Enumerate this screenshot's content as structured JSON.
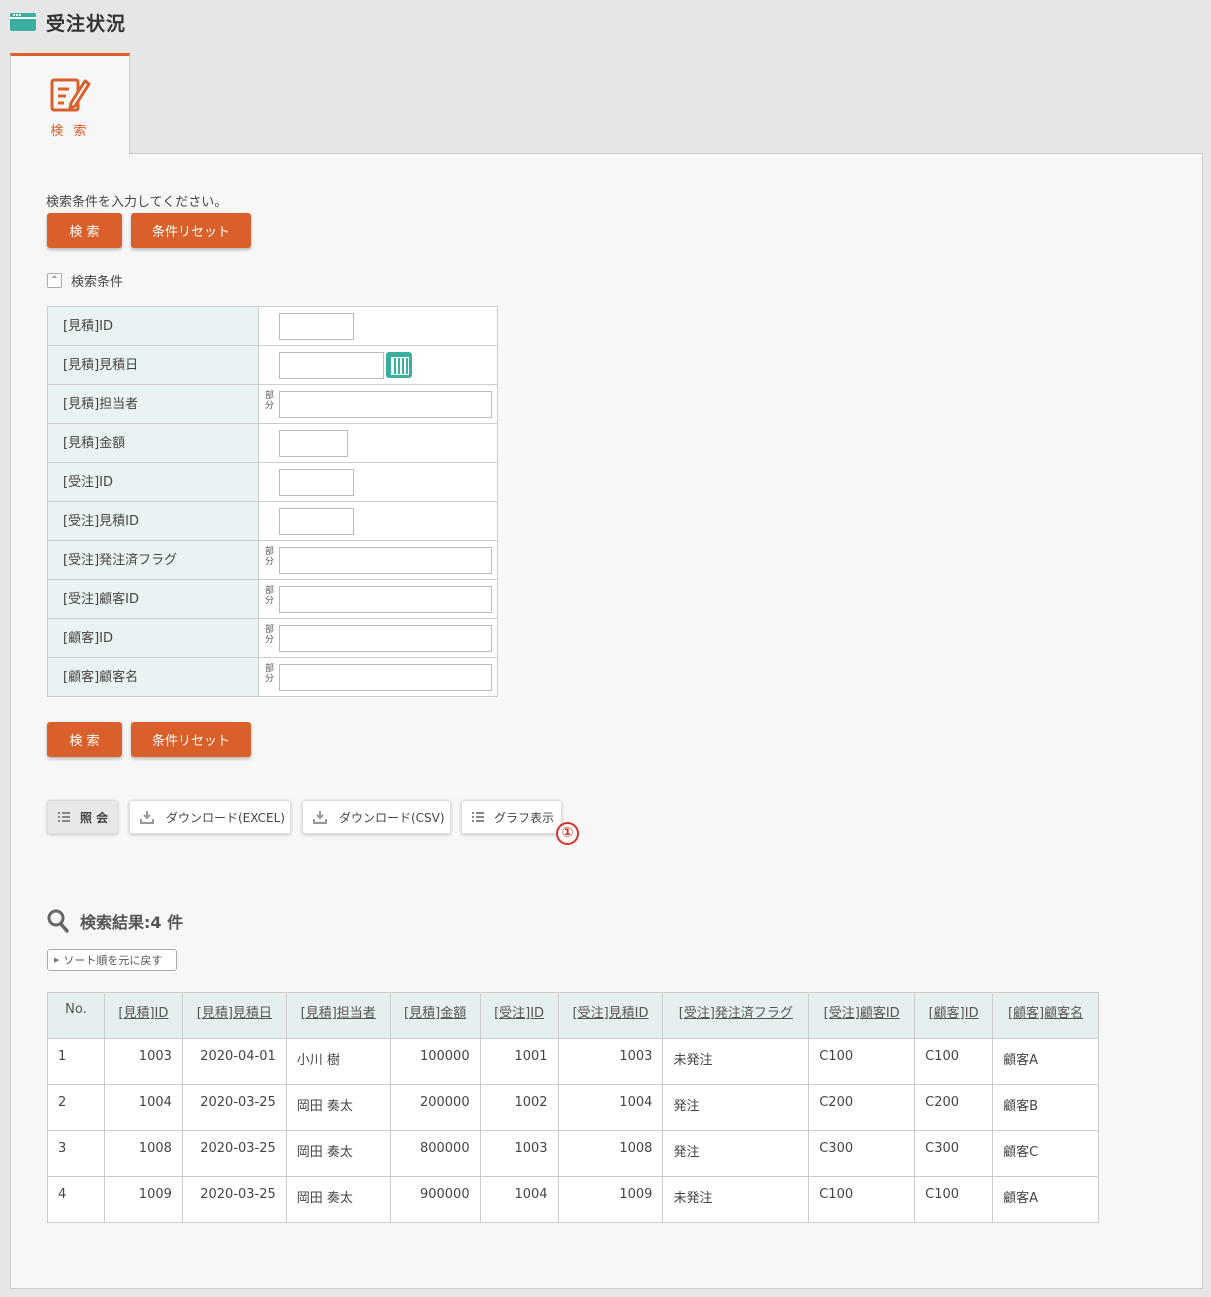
{
  "header": {
    "title": "受注状況",
    "icon": "window-icon"
  },
  "tab": {
    "label": "検 索",
    "icon": "edit-form-icon"
  },
  "form": {
    "instruction": "検索条件を入力してください。",
    "search_label": "検 索",
    "reset_label": "条件リセット",
    "conditions_toggle": "検索条件",
    "partial_label": "部分",
    "fields": [
      {
        "label": "[見積]ID",
        "value": ""
      },
      {
        "label": "[見積]見積日",
        "value": ""
      },
      {
        "label": "[見積]担当者",
        "value": ""
      },
      {
        "label": "[見積]金額",
        "value": ""
      },
      {
        "label": "[受注]ID",
        "value": ""
      },
      {
        "label": "[受注]見積ID",
        "value": ""
      },
      {
        "label": "[受注]発注済フラグ",
        "value": ""
      },
      {
        "label": "[受注]顧客ID",
        "value": ""
      },
      {
        "label": "[顧客]ID",
        "value": ""
      },
      {
        "label": "[顧客]顧客名",
        "value": ""
      }
    ]
  },
  "toolbar": {
    "view_label": "照 会",
    "download_excel_label": "ダウンロード(EXCEL)",
    "download_csv_label": "ダウンロード(CSV)",
    "graph_label": "グラフ表示",
    "marker": "1"
  },
  "results": {
    "title": "検索結果:4 件",
    "sort_reset_label": "ソート順を元に戻す",
    "columns": [
      "No.",
      "[見積]ID",
      "[見積]見積日",
      "[見積]担当者",
      "[見積]金額",
      "[受注]ID",
      "[受注]見積ID",
      "[受注]発注済フラグ",
      "[受注]顧客ID",
      "[顧客]ID",
      "[顧客]顧客名"
    ],
    "rows": [
      [
        "1",
        "1003",
        "2020-04-01",
        "小川 樹",
        "100000",
        "1001",
        "1003",
        "未発注",
        "C100",
        "C100",
        "顧客A"
      ],
      [
        "2",
        "1004",
        "2020-03-25",
        "岡田 奏太",
        "200000",
        "1002",
        "1004",
        "発注",
        "C200",
        "C200",
        "顧客B"
      ],
      [
        "3",
        "1008",
        "2020-03-25",
        "岡田 奏太",
        "800000",
        "1003",
        "1008",
        "発注",
        "C300",
        "C300",
        "顧客C"
      ],
      [
        "4",
        "1009",
        "2020-03-25",
        "岡田 奏太",
        "900000",
        "1004",
        "1009",
        "未発注",
        "C100",
        "C100",
        "顧客A"
      ]
    ]
  },
  "colors": {
    "accent": "#d9602a",
    "teal": "#3aafa0",
    "label_bg": "#eaf3f3",
    "marker": "#d9302a"
  }
}
